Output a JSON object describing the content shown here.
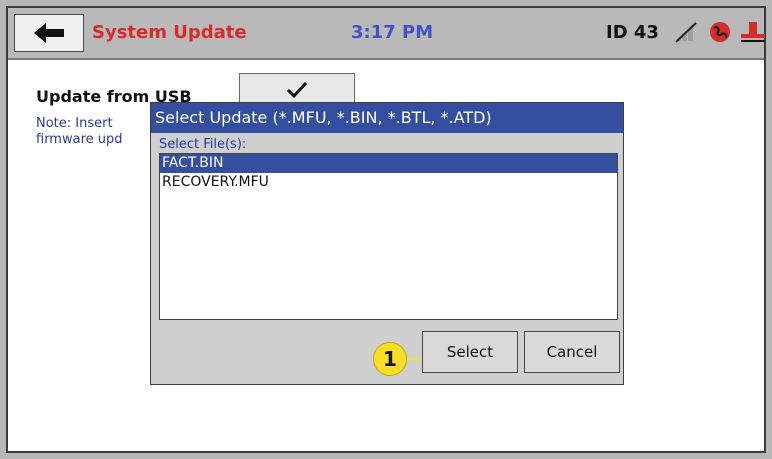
{
  "window": {
    "title": "System Update",
    "time": "3:17 PM",
    "id_label": "ID 43"
  },
  "icons": {
    "back": "back-arrow-icon",
    "signal": "no-signal-icon",
    "network": "globe-icon",
    "usb": "usb-icon"
  },
  "main": {
    "update_heading": "Update from USB",
    "note_text": "Note: Insert\nfirmware upd"
  },
  "dialog": {
    "title": "Select Update (*.MFU, *.BIN, *.BTL, *.ATD)",
    "files_label": "Select File(s):",
    "files": [
      "FACT.BIN",
      "RECOVERY.MFU"
    ],
    "selected_file": "FACT.BIN",
    "select_label": "Select",
    "cancel_label": "Cancel"
  },
  "callout": {
    "number": "1"
  },
  "colors": {
    "title_red": "#d52b2b",
    "time_blue": "#3f53c6",
    "dialog_blue": "#344fa0",
    "callout_yellow": "#f8de2a"
  }
}
